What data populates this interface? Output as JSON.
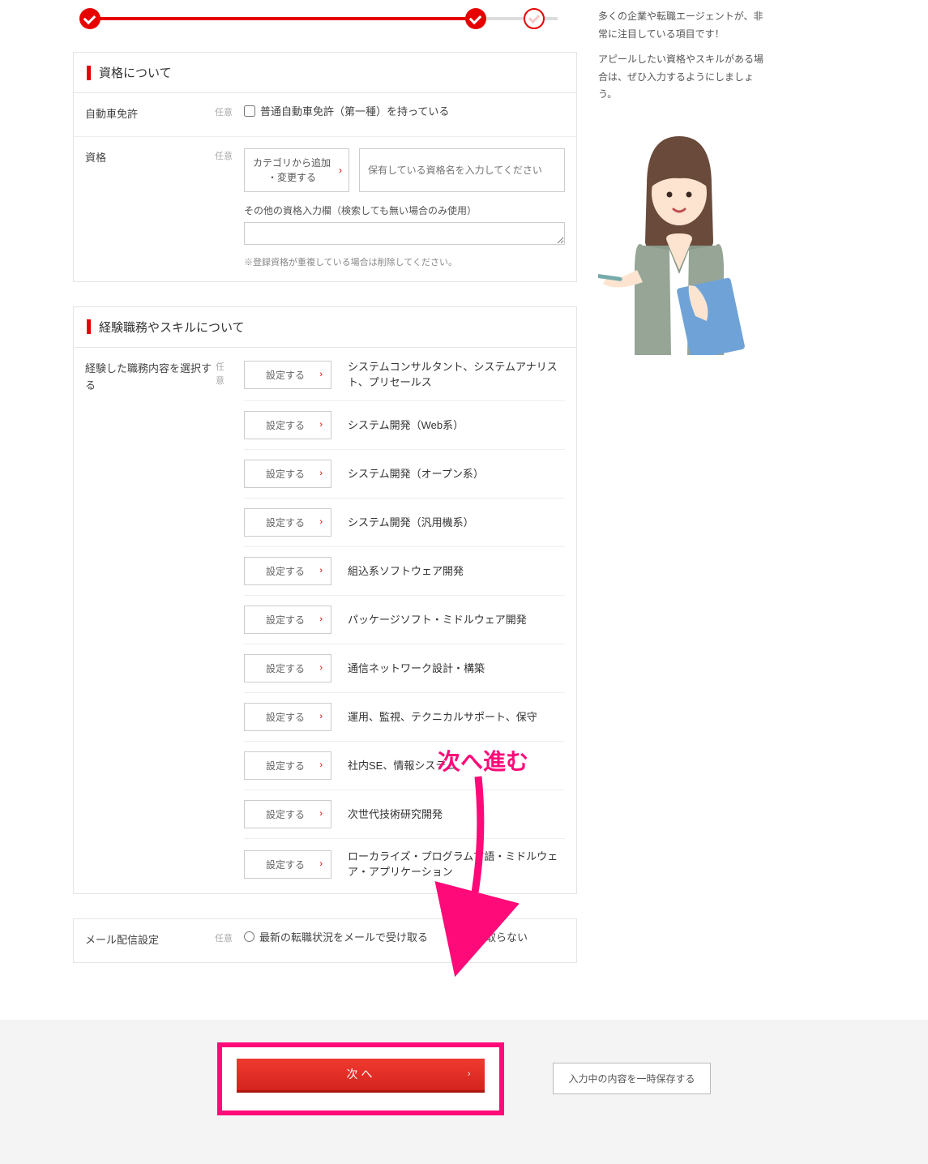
{
  "sections": {
    "qualifications": {
      "title": "資格について",
      "license": {
        "label": "自動車免許",
        "tag": "任意",
        "checkbox": "普通自動車免許（第一種）を持っている"
      },
      "quals": {
        "label": "資格",
        "tag": "任意",
        "addBtn": "カテゴリから追加\n・変更する",
        "placeholder": "保有している資格名を入力してください",
        "otherLabel": "その他の資格入力欄（検索しても無い場合のみ使用）",
        "note": "※登録資格が重複している場合は削除してください。"
      }
    },
    "skills": {
      "title": "経験職務やスキルについて",
      "rowLabel": "経験した職務内容を選択する",
      "rowTag": "任意",
      "setBtn": "設定する",
      "items": [
        "システムコンサルタント、システムアナリスト、プリセールス",
        "システム開発（Web系）",
        "システム開発（オープン系）",
        "システム開発（汎用機系）",
        "組込系ソフトウェア開発",
        "パッケージソフト・ミドルウェア開発",
        "通信ネットワーク設計・構築",
        "運用、監視、テクニカルサポート、保守",
        "社内SE、情報システム",
        "次世代技術研究開発",
        "ローカライズ・プログラム言語・ミドルウェア・アプリケーション"
      ]
    },
    "mail": {
      "label": "メール配信設定",
      "tag": "任意",
      "opt1": "最新の転職状況をメールで受け取る",
      "opt2": "受け取らない"
    }
  },
  "side": {
    "p1": "多くの企業や転職エージェントが、非常に注目している項目です！",
    "p2": "アピールしたい資格やスキルがある場合は、ぜひ入力するようにしましょう。"
  },
  "annotation": "次へ進む",
  "footer": {
    "next": "次へ",
    "save": "入力中の内容を一時保存する"
  }
}
